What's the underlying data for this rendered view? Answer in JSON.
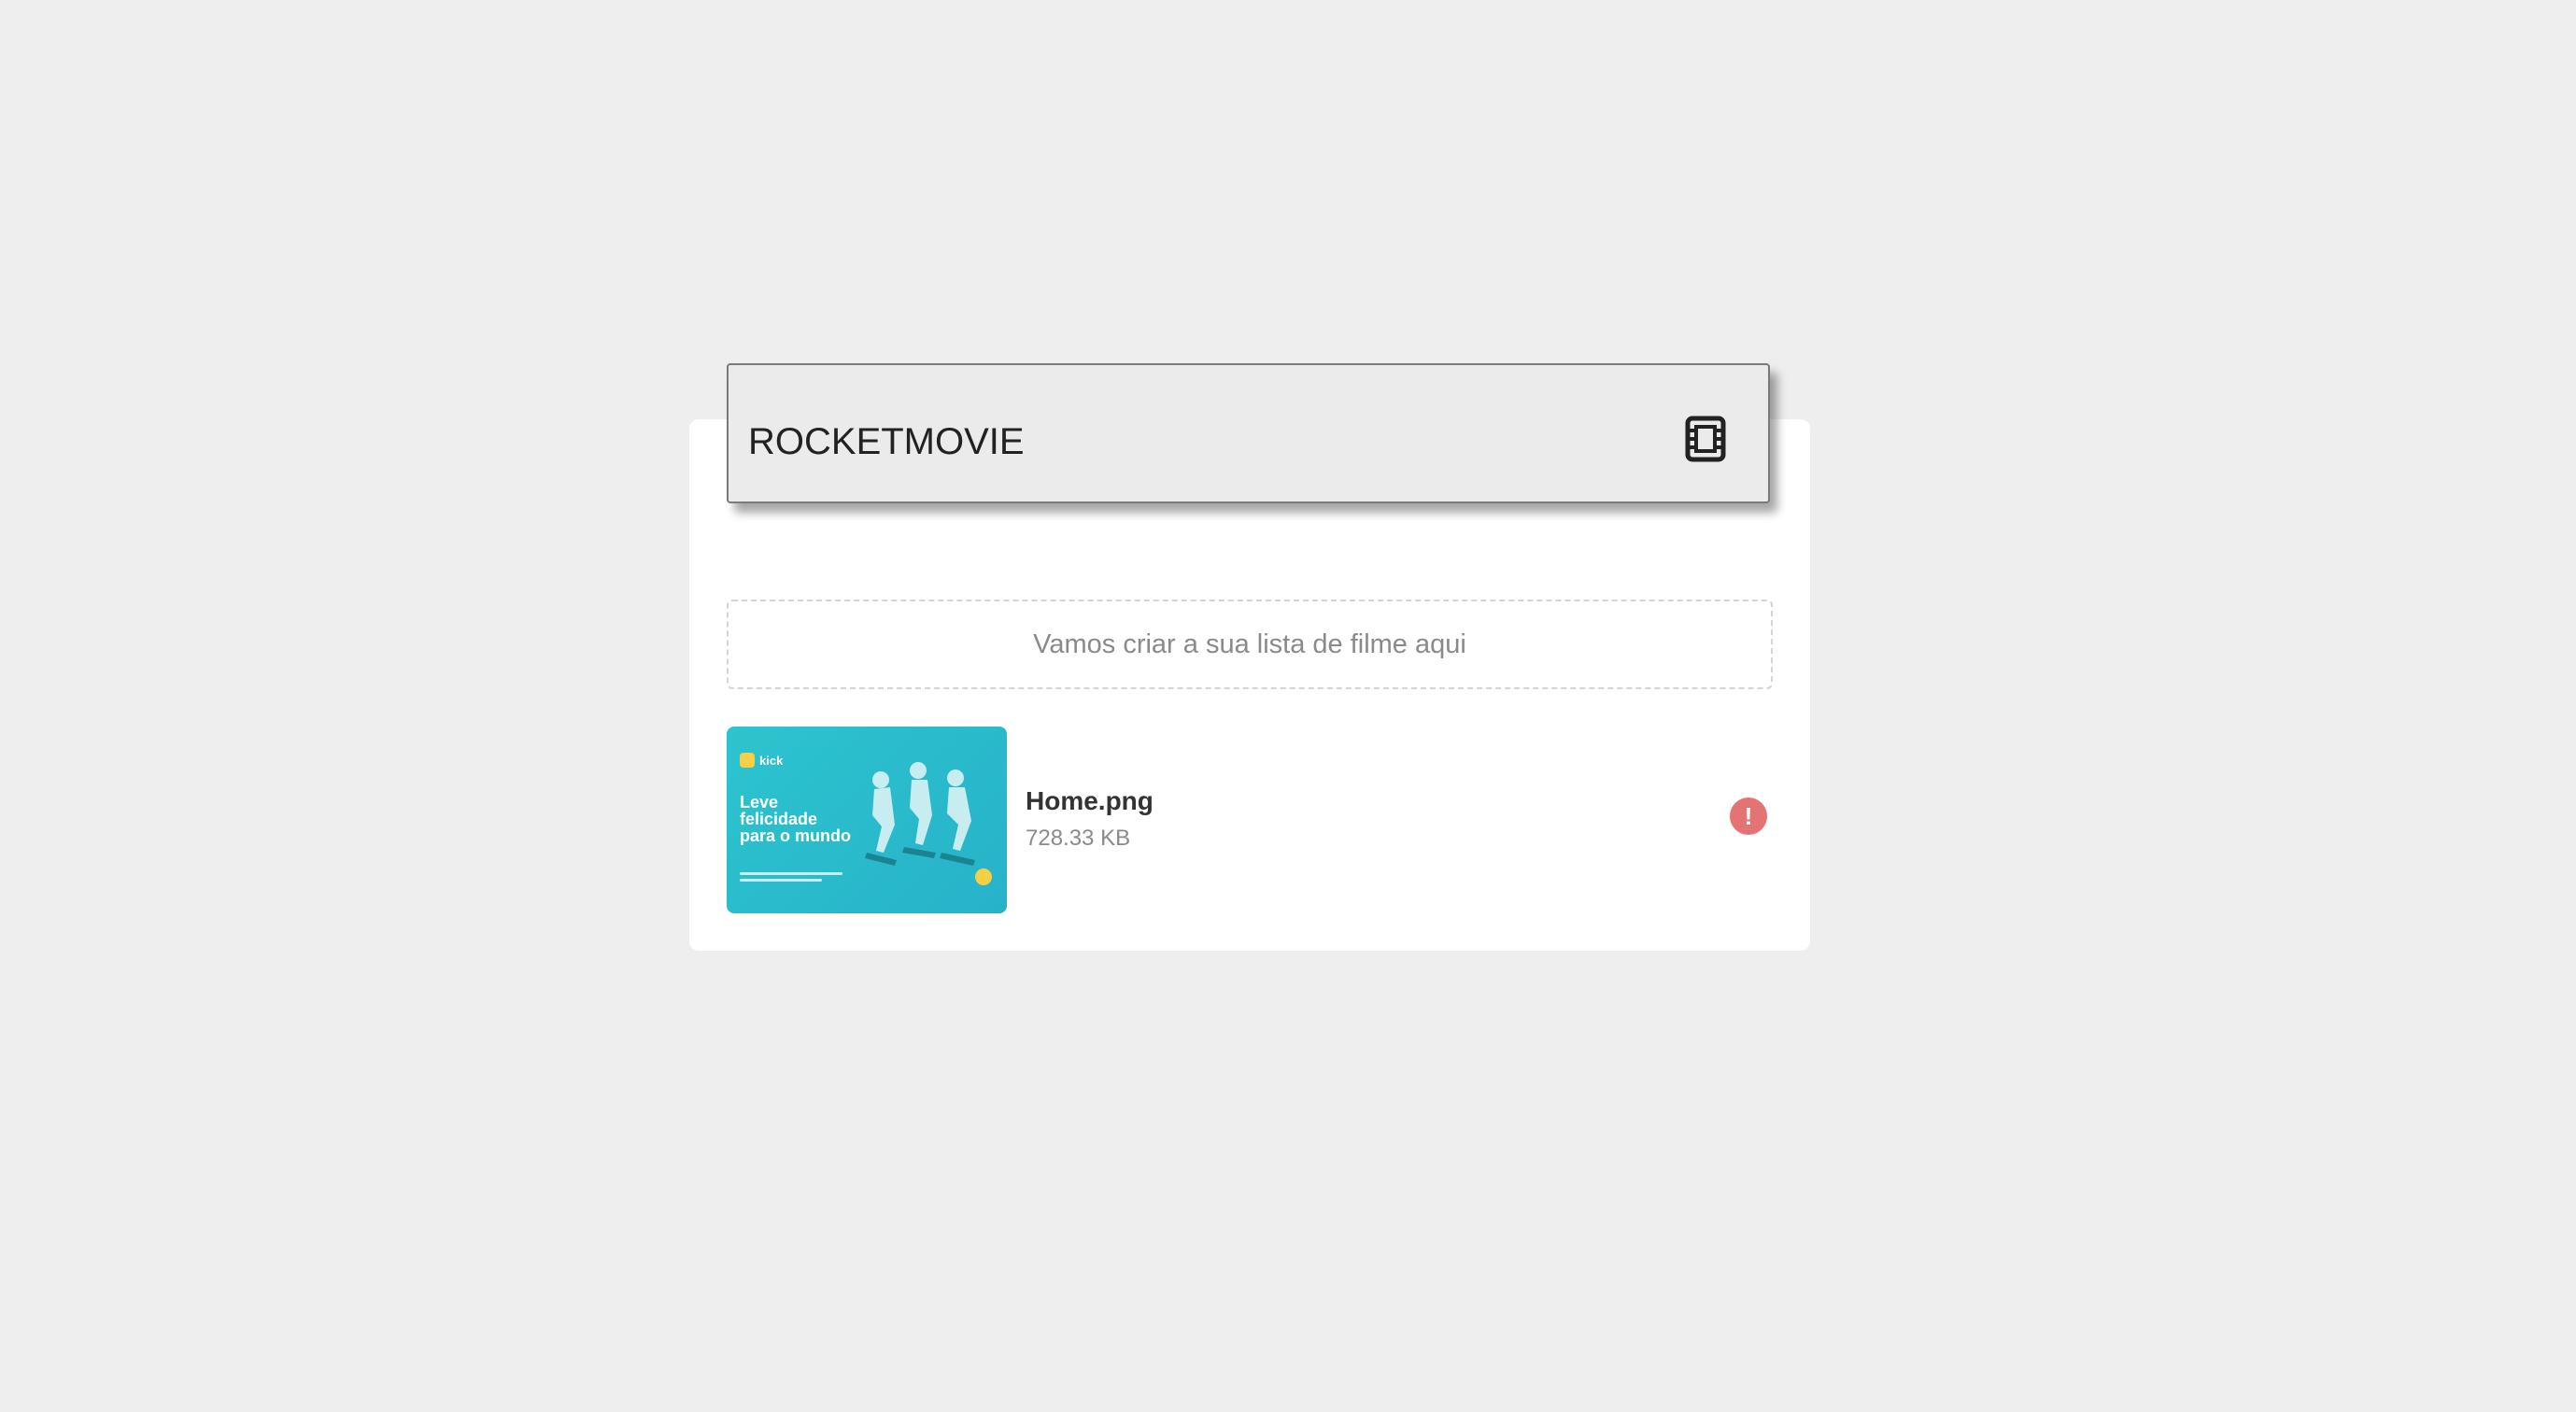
{
  "header": {
    "title": "ROCKETMOVIE",
    "icon": "film-icon"
  },
  "dropzone": {
    "text": "Vamos criar a sua lista de filme aqui"
  },
  "file": {
    "name": "Home.png",
    "size": "728.33 KB",
    "status_icon": "error-icon",
    "status_color": "#e57373",
    "thumbnail": {
      "brand": "kick",
      "headline": "Leve felicidade para o mundo",
      "background": "#2cc4cf"
    }
  }
}
